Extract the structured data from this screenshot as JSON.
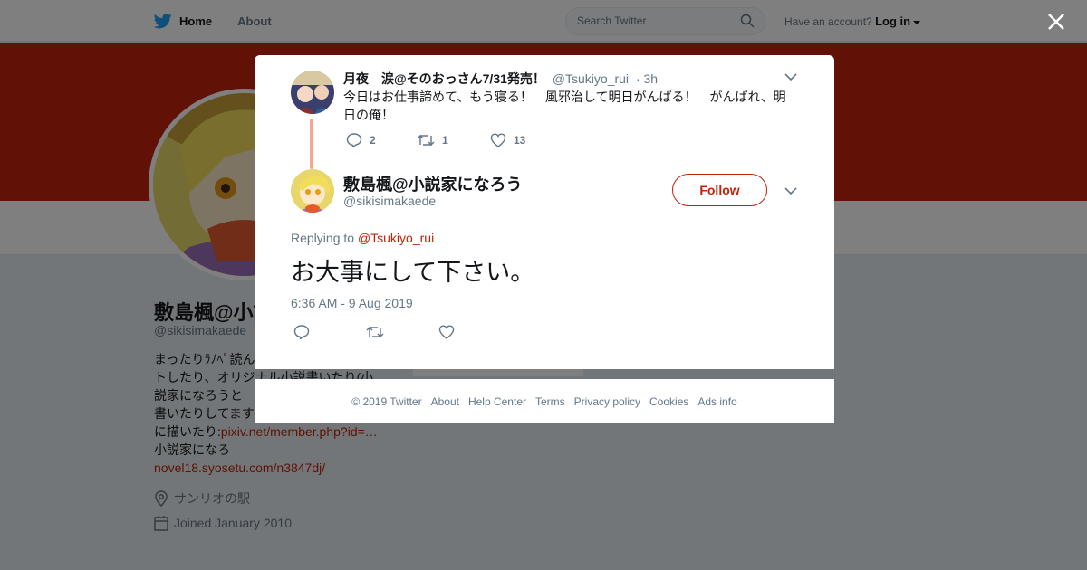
{
  "topnav": {
    "home_label": "Home",
    "about_label": "About",
    "search_placeholder": "Search Twitter",
    "account_prompt": "Have an account?",
    "login_label": "Log in"
  },
  "profile": {
    "name": "敷島楓@小説家になろう",
    "name_visible": "敷島楓@小説",
    "handle": "@sikisimakaede",
    "bio_lines": [
      "まったりﾗﾉﾍﾞ読ん",
      "トしたり、オリジナル小説書いたり(小",
      "説家になろうと",
      "書いたりしてます",
      "に描いたり:"
    ],
    "bio_link1": "pixiv.net/member.php?id=…",
    "bio_line_after": "小説家になろ",
    "bio_link2": "novel18.syosetu.com/n3847dj/",
    "location": "サンリオの駅",
    "joined": "Joined January 2010"
  },
  "parent_tweet": {
    "author_name": "月夜　涙@そのおっさん7/31発売！",
    "author_handle": "@Tsukiyo_rui",
    "time": "· 3h",
    "text": "今日はお仕事諦めて、もう寝る！　風邪治して明日がんばる！　がんばれ、明日の俺！",
    "reply_count": "2",
    "retweet_count": "1",
    "like_count": "13"
  },
  "main_tweet": {
    "author_name": "敷島楓@小説家になろう",
    "author_handle": "@sikisimakaede",
    "follow_label": "Follow",
    "replying_prefix": "Replying to",
    "replying_to": "@Tsukiyo_rui",
    "text": "お大事にして下さい。",
    "timestamp": "6:36 AM - 9 Aug 2019"
  },
  "footer": {
    "items": [
      "© 2019 Twitter",
      "About",
      "Help Center",
      "Terms",
      "Privacy policy",
      "Cookies",
      "Ads info"
    ]
  },
  "colors": {
    "accent": "#c2220b",
    "twitter_blue": "#1da1f2",
    "thread_line": "#f4a791",
    "muted": "#657786"
  },
  "icons": [
    "twitter-bird-icon",
    "search-icon",
    "caret-down-icon",
    "close-icon",
    "location-icon",
    "calendar-icon",
    "reply-icon",
    "retweet-icon",
    "like-icon",
    "chevron-down-icon"
  ]
}
